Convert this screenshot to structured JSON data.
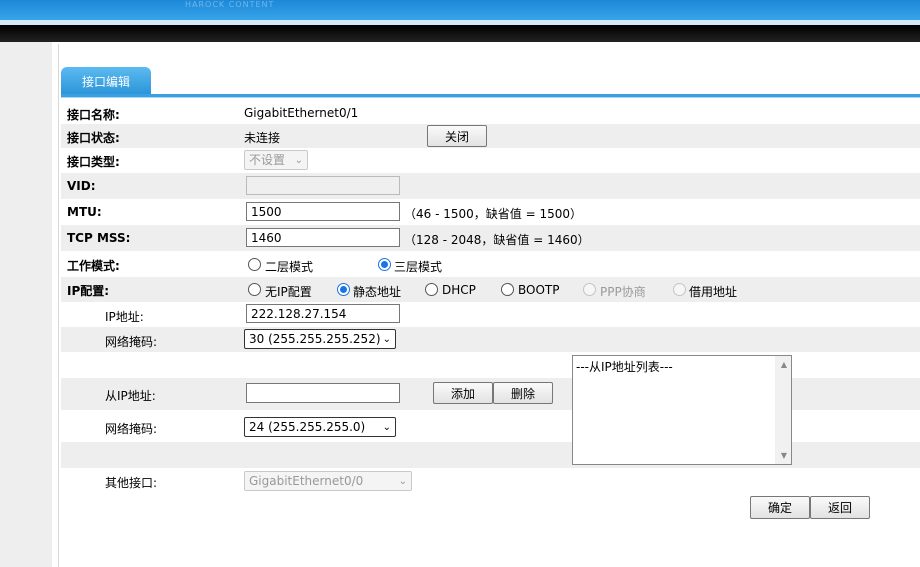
{
  "header": {
    "banner_text": "HAROCK CONTENT"
  },
  "tab": {
    "label": "接口编辑"
  },
  "form": {
    "name": {
      "label": "接口名称:",
      "value": "GigabitEthernet0/1"
    },
    "status": {
      "label": "接口状态:",
      "value": "未连接",
      "button": "关闭"
    },
    "type": {
      "label": "接口类型:",
      "selected": "不设置"
    },
    "vid": {
      "label": "VID:",
      "value": ""
    },
    "mtu": {
      "label": "MTU:",
      "value": "1500",
      "hint": "（46 - 1500，缺省值 = 1500）"
    },
    "mss": {
      "label": "TCP MSS:",
      "value": "1460",
      "hint": "（128 - 2048，缺省值 = 1460）"
    },
    "mode": {
      "label": "工作模式:",
      "options": [
        "二层模式",
        "三层模式"
      ],
      "selected": "三层模式"
    },
    "ipconf": {
      "label": "IP配置:",
      "options": [
        "无IP配置",
        "静态地址",
        "DHCP",
        "BOOTP",
        "PPP协商",
        "借用地址"
      ],
      "selected": "静态地址"
    },
    "ip": {
      "label": "IP地址:",
      "value": "222.128.27.154"
    },
    "mask": {
      "label": "网络掩码:",
      "selected": "30 (255.255.255.252)"
    },
    "secondary_ip": {
      "label": "从IP地址:",
      "value": "",
      "add": "添加",
      "delete": "删除"
    },
    "secondary_list": {
      "placeholder": "---从IP地址列表---"
    },
    "mask2": {
      "label": "网络掩码:",
      "selected": "24 (255.255.255.0)"
    },
    "other_iface": {
      "label": "其他接口:",
      "selected": "GigabitEthernet0/0"
    }
  },
  "actions": {
    "ok": "确定",
    "back": "返回"
  },
  "colors": {
    "accent": "#3aa0e2",
    "row_gray": "#eeeeee",
    "radio_on": "#1a73e8"
  }
}
